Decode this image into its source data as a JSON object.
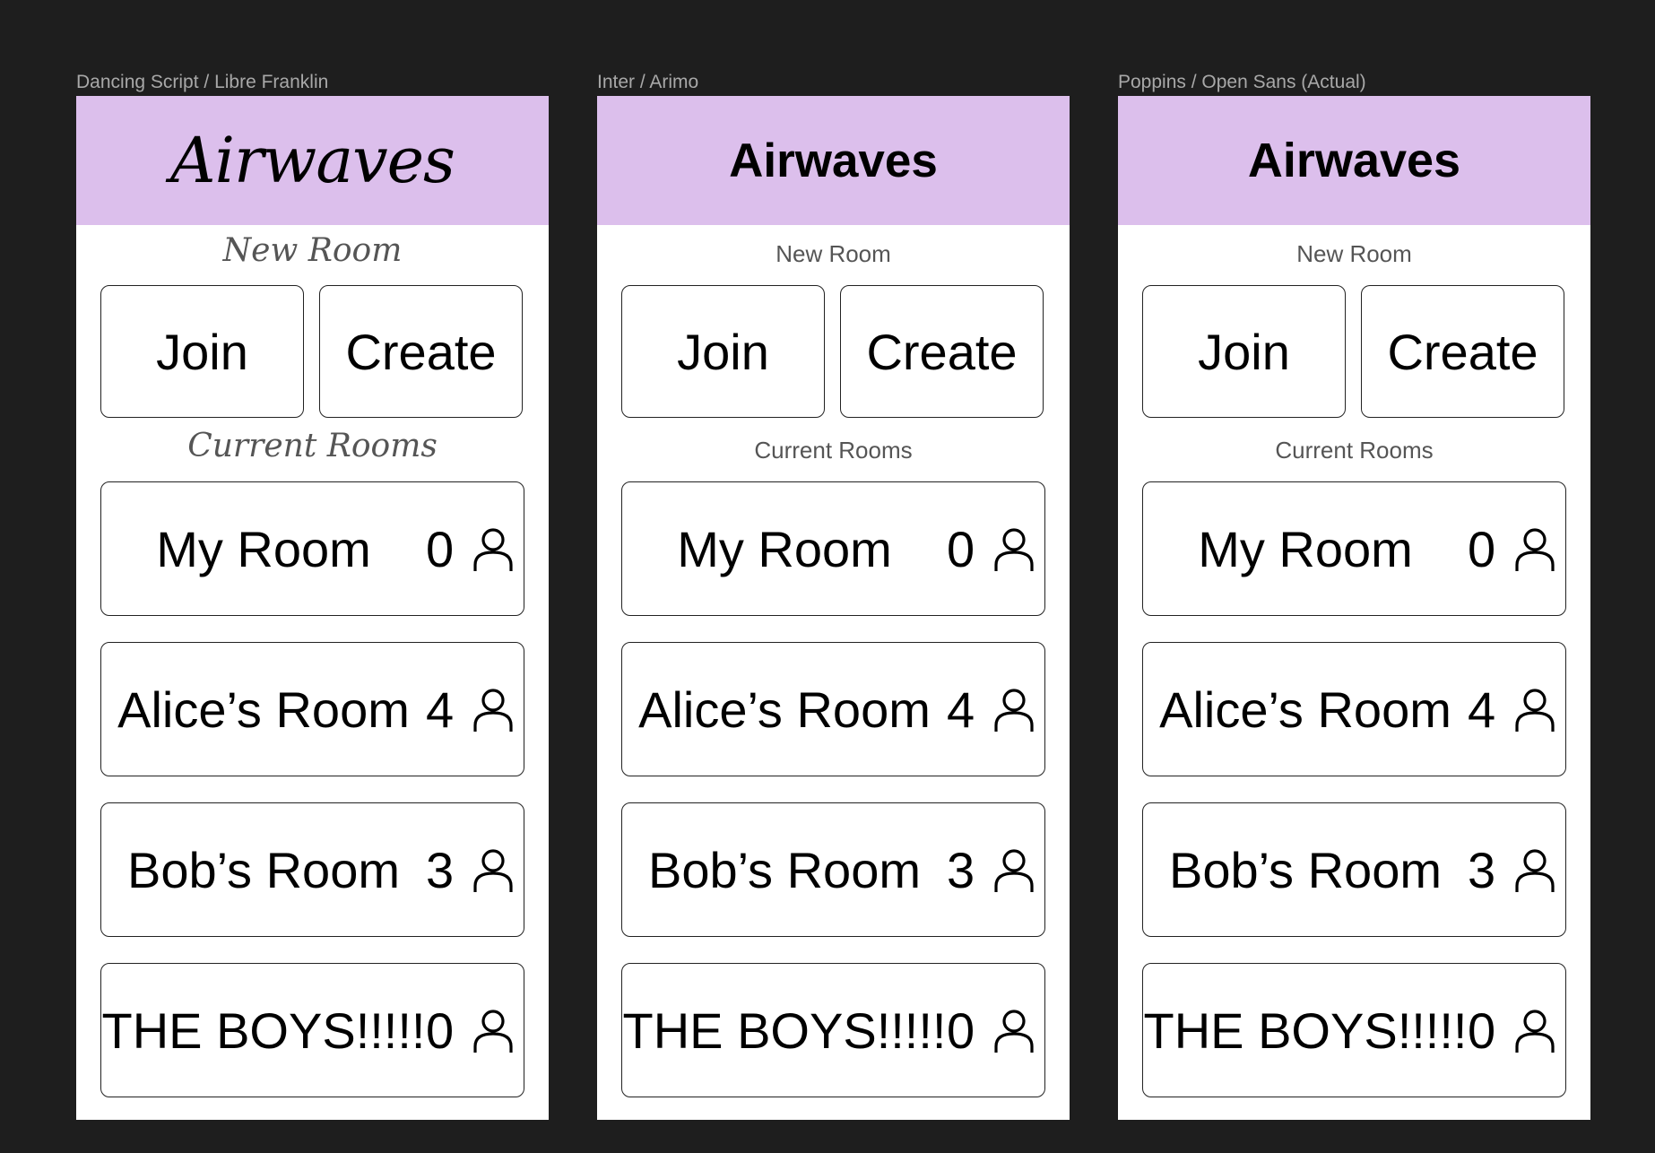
{
  "frames": [
    {
      "label": "Dancing Script / Libre Franklin",
      "title": "Airwaves",
      "new_room_label": "New Room",
      "join_label": "Join",
      "create_label": "Create",
      "current_rooms_label": "Current Rooms",
      "rooms": [
        {
          "name": "My Room",
          "count": "0"
        },
        {
          "name": "Alice’s Room",
          "count": "4"
        },
        {
          "name": "Bob’s Room",
          "count": "3"
        },
        {
          "name": "THE BOYS!!!!!",
          "count": "0"
        }
      ]
    },
    {
      "label": "Inter / Arimo",
      "title": "Airwaves",
      "new_room_label": "New Room",
      "join_label": "Join",
      "create_label": "Create",
      "current_rooms_label": "Current Rooms",
      "rooms": [
        {
          "name": "My Room",
          "count": "0"
        },
        {
          "name": "Alice’s Room",
          "count": "4"
        },
        {
          "name": "Bob’s Room",
          "count": "3"
        },
        {
          "name": "THE BOYS!!!!!",
          "count": "0"
        }
      ]
    },
    {
      "label": "Poppins / Open Sans (Actual)",
      "title": "Airwaves",
      "new_room_label": "New Room",
      "join_label": "Join",
      "create_label": "Create",
      "current_rooms_label": "Current Rooms",
      "rooms": [
        {
          "name": "My Room",
          "count": "0"
        },
        {
          "name": "Alice’s Room",
          "count": "4"
        },
        {
          "name": "Bob’s Room",
          "count": "3"
        },
        {
          "name": "THE BOYS!!!!!",
          "count": "0"
        }
      ]
    }
  ],
  "colors": {
    "canvas": "#1e1e1e",
    "header": "#dcbfec",
    "frame_background": "#ffffff"
  },
  "icons": {
    "room_count": "user-icon"
  }
}
